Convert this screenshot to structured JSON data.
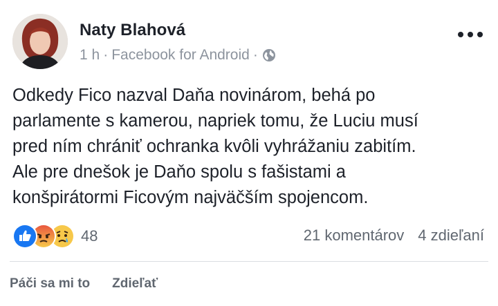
{
  "post": {
    "author": "Naty Blahová",
    "time": "1 h",
    "separator": "·",
    "source": "Facebook for Android",
    "audience_icon": "globe-icon",
    "lines": [
      "Odkedy Fico nazval Daňa novinárom, behá po",
      "parlamente s kamerou, napriek tomu, že Luciu musí",
      "pred ním chrániť ochranka kvôli vyhrážaniu zabitím.",
      "Ale pre dnešok je Daňo spolu s fašistami a",
      "konšpirátormi Ficovým najväčším spojencom."
    ]
  },
  "stats": {
    "reaction_icons": [
      "like-icon",
      "angry-icon",
      "sad-icon"
    ],
    "reaction_count": "48",
    "comments": "21 komentárov",
    "shares": "4 zdieľaní"
  },
  "actions": {
    "like": "Páči sa mi to",
    "share": "Zdieľať"
  },
  "colors": {
    "text": "#1d2129",
    "meta": "#8d949e",
    "like_blue": "#1877f2",
    "angry_red": "#e9573f",
    "sad_yellow": "#f7c84a"
  }
}
